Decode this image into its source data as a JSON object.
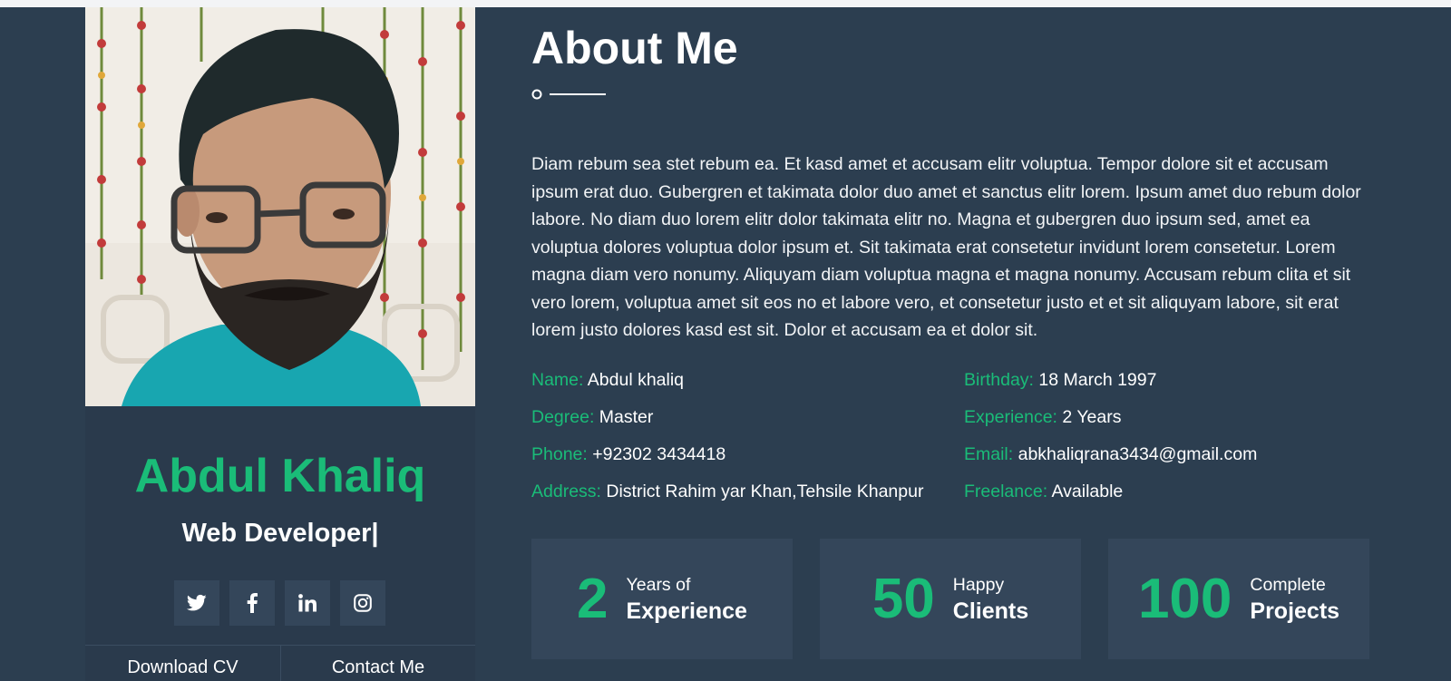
{
  "profile": {
    "name": "Abdul Khaliq",
    "role": "Web Developer|",
    "socials": [
      {
        "icon": "twitter-icon"
      },
      {
        "icon": "facebook-icon"
      },
      {
        "icon": "linkedin-icon"
      },
      {
        "icon": "instagram-icon"
      }
    ],
    "actions": {
      "download_label": "Download CV",
      "contact_label": "Contact Me"
    }
  },
  "about": {
    "title": "About Me",
    "bio": "Diam rebum sea stet rebum ea. Et kasd amet et accusam elitr voluptua. Tempor dolore sit et accusam ipsum erat duo. Gubergren et takimata dolor duo amet et sanctus elitr lorem. Ipsum amet duo rebum dolor labore. No diam duo lorem elitr dolor takimata elitr no. Magna et gubergren duo ipsum sed, amet ea voluptua dolores voluptua dolor ipsum et. Sit takimata erat consetetur invidunt lorem consetetur. Lorem magna diam vero nonumy. Aliquyam diam voluptua magna et magna nonumy. Accusam rebum clita et sit vero lorem, voluptua amet sit eos no et labore vero, et consetetur justo et et sit aliquyam labore, sit erat lorem justo dolores kasd est sit. Dolor et accusam ea et dolor sit."
  },
  "info": {
    "left": [
      {
        "label": "Name:",
        "value": "Abdul khaliq"
      },
      {
        "label": "Degree:",
        "value": "Master"
      },
      {
        "label": "Phone:",
        "value": "+92302 3434418"
      },
      {
        "label": "Address:",
        "value": "District Rahim yar Khan,Tehsile Khanpur"
      }
    ],
    "right": [
      {
        "label": "Birthday:",
        "value": "18 March 1997"
      },
      {
        "label": "Experience:",
        "value": "2 Years"
      },
      {
        "label": "Email:",
        "value": "abkhaliqrana3434@gmail.com"
      },
      {
        "label": "Freelance:",
        "value": "Available"
      }
    ]
  },
  "stats": [
    {
      "number": "2",
      "line1": "Years of",
      "line2": "Experience"
    },
    {
      "number": "50",
      "line1": "Happy",
      "line2": "Clients"
    },
    {
      "number": "100",
      "line1": "Complete",
      "line2": "Projects"
    }
  ],
  "colors": {
    "background": "#2c3e50",
    "card": "#2a3a4c",
    "box": "#34465a",
    "accent": "#1abc78",
    "text": "#ffffff"
  }
}
